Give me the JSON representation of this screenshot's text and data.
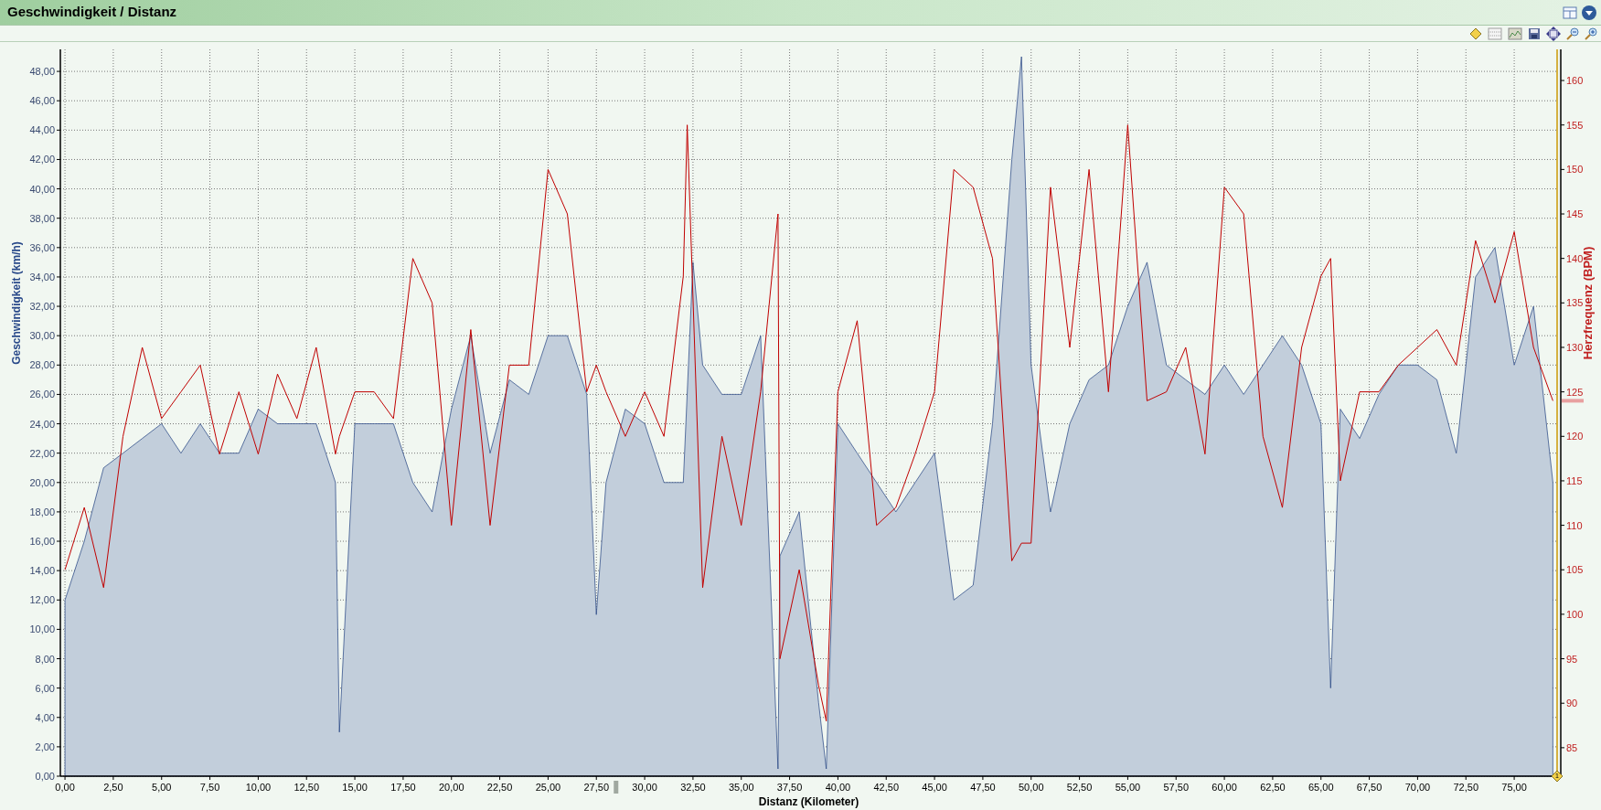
{
  "window": {
    "title": "Geschwindigkeit / Distanz"
  },
  "chart": {
    "marker_label": "1",
    "speed_chart": {
      "chart_data": {
        "type": "area",
        "grid": true,
        "xlabel": "Distanz (Kilometer)",
        "ylabel": "Geschwindigkeit (km/h)",
        "x": [
          0,
          1,
          2,
          3,
          4,
          5,
          6,
          7,
          8,
          9,
          10,
          11,
          12,
          13,
          14,
          14.2,
          15,
          16,
          17,
          18,
          19,
          20,
          21,
          22,
          23,
          24,
          25,
          26,
          27,
          27.5,
          28,
          29,
          30,
          31,
          32,
          32.5,
          33,
          34,
          35,
          36,
          36.9,
          37,
          38,
          39,
          39.4,
          40,
          41,
          42,
          43,
          44,
          45,
          46,
          47,
          48,
          49,
          49.5,
          50,
          51,
          52,
          53,
          54,
          55,
          56,
          57,
          58,
          59,
          60,
          61,
          62,
          63,
          64,
          65,
          65.5,
          66,
          67,
          68,
          69,
          70,
          71,
          72,
          73,
          74,
          75,
          76,
          77
        ],
        "series": [
          {
            "color": "#1f3f80",
            "values": [
              12,
              16,
              21,
              22,
              23,
              24,
              22,
              24,
              22,
              22,
              25,
              24,
              24,
              24,
              20,
              3,
              24,
              24,
              24,
              20,
              18,
              25,
              30,
              22,
              27,
              26,
              30,
              30,
              26,
              11,
              20,
              25,
              24,
              20,
              20,
              35,
              28,
              26,
              26,
              30,
              0.5,
              15,
              18,
              5,
              0.5,
              24,
              22,
              20,
              18,
              20,
              22,
              12,
              13,
              24,
              42,
              49,
              28,
              18,
              24,
              27,
              28,
              32,
              35,
              28,
              27,
              26,
              28,
              26,
              28,
              30,
              28,
              24,
              6,
              25,
              23,
              26,
              28,
              28,
              27,
              22,
              34,
              36,
              28,
              32,
              20
            ]
          }
        ],
        "xlim": [
          -0.24,
          77.22
        ],
        "ylim": [
          0,
          49.5
        ],
        "xticks": [
          {
            "value": 0,
            "label": "0,00"
          },
          {
            "value": 2.5,
            "label": "2,50"
          },
          {
            "value": 5,
            "label": "5,00"
          },
          {
            "value": 7.5,
            "label": "7,50"
          },
          {
            "value": 10,
            "label": "10,00"
          },
          {
            "value": 12.5,
            "label": "12,50"
          },
          {
            "value": 15,
            "label": "15,00"
          },
          {
            "value": 17.5,
            "label": "17,50"
          },
          {
            "value": 20,
            "label": "20,00"
          },
          {
            "value": 22.5,
            "label": "22,50"
          },
          {
            "value": 25,
            "label": "25,00"
          },
          {
            "value": 27.5,
            "label": "27,50"
          },
          {
            "value": 30,
            "label": "30,00"
          },
          {
            "value": 32.5,
            "label": "32,50"
          },
          {
            "value": 35,
            "label": "35,00"
          },
          {
            "value": 37.5,
            "label": "37,50"
          },
          {
            "value": 40,
            "label": "40,00"
          },
          {
            "value": 42.5,
            "label": "42,50"
          },
          {
            "value": 45,
            "label": "45,00"
          },
          {
            "value": 47.5,
            "label": "47,50"
          },
          {
            "value": 50,
            "label": "50,00"
          },
          {
            "value": 52.5,
            "label": "52,50"
          },
          {
            "value": 55,
            "label": "55,00"
          },
          {
            "value": 57.5,
            "label": "57,50"
          },
          {
            "value": 60,
            "label": "60,00"
          },
          {
            "value": 62.5,
            "label": "62,50"
          },
          {
            "value": 65,
            "label": "65,00"
          },
          {
            "value": 67.5,
            "label": "67,50"
          },
          {
            "value": 70,
            "label": "70,00"
          },
          {
            "value": 72.5,
            "label": "72,50"
          },
          {
            "value": 75,
            "label": "75,00"
          }
        ],
        "yticks": [
          {
            "value": 0,
            "label": "0,00"
          },
          {
            "value": 2,
            "label": "2,00"
          },
          {
            "value": 4,
            "label": "4,00"
          },
          {
            "value": 6,
            "label": "6,00"
          },
          {
            "value": 8,
            "label": "8,00"
          },
          {
            "value": 10,
            "label": "10,00"
          },
          {
            "value": 12,
            "label": "12,00"
          },
          {
            "value": 14,
            "label": "14,00"
          },
          {
            "value": 16,
            "label": "16,00"
          },
          {
            "value": 18,
            "label": "18,00"
          },
          {
            "value": 20,
            "label": "20,00"
          },
          {
            "value": 22,
            "label": "22,00"
          },
          {
            "value": 24,
            "label": "24,00"
          },
          {
            "value": 26,
            "label": "26,00"
          },
          {
            "value": 28,
            "label": "28,00"
          },
          {
            "value": 30,
            "label": "30,00"
          },
          {
            "value": 32,
            "label": "32,00"
          },
          {
            "value": 34,
            "label": "34,00"
          },
          {
            "value": 36,
            "label": "36,00"
          },
          {
            "value": 38,
            "label": "38,00"
          },
          {
            "value": 40,
            "label": "40,00"
          },
          {
            "value": 42,
            "label": "42,00"
          },
          {
            "value": 44,
            "label": "44,00"
          },
          {
            "value": 46,
            "label": "46,00"
          },
          {
            "value": 48,
            "label": "48,00"
          }
        ]
      }
    },
    "heart_rate_chart": {
      "chart_data": {
        "type": "line",
        "ylabel": "Herzfrequenz (BPM)",
        "x": [
          0,
          1,
          2,
          3,
          4,
          5,
          6,
          7,
          8,
          9,
          10,
          11,
          12,
          13,
          14,
          14.2,
          15,
          16,
          17,
          18,
          19,
          20,
          21,
          22,
          23,
          24,
          25,
          26,
          27,
          27.5,
          28,
          29,
          30,
          31,
          32,
          32.2,
          33,
          34,
          35,
          36,
          36.9,
          37,
          38,
          39,
          39.4,
          40,
          41,
          42,
          43,
          44,
          45,
          46,
          47,
          48,
          49,
          49.5,
          50,
          51,
          52,
          53,
          54,
          55,
          56,
          57,
          58,
          59,
          60,
          61,
          62,
          63,
          64,
          65,
          65.5,
          66,
          67,
          68,
          69,
          70,
          71,
          72,
          73,
          74,
          75,
          76,
          77
        ],
        "series": [
          {
            "color": "#c00000",
            "values": [
              105,
              112,
              103,
              120,
              130,
              122,
              125,
              128,
              118,
              125,
              118,
              127,
              122,
              130,
              118,
              120,
              125,
              125,
              122,
              140,
              135,
              110,
              132,
              110,
              128,
              128,
              150,
              145,
              125,
              128,
              125,
              120,
              125,
              120,
              138,
              155,
              103,
              120,
              110,
              125,
              145,
              95,
              105,
              92,
              88,
              125,
              133,
              110,
              112,
              118,
              125,
              150,
              148,
              140,
              106,
              108,
              108,
              148,
              130,
              150,
              125,
              155,
              124,
              125,
              130,
              118,
              148,
              145,
              120,
              112,
              130,
              138,
              140,
              115,
              125,
              125,
              128,
              130,
              132,
              128,
              142,
              135,
              143,
              130,
              124
            ]
          }
        ],
        "xlim": [
          -0.24,
          77.22
        ],
        "ylim": [
          81.8,
          163.5
        ],
        "yticks": [
          85,
          90,
          95,
          100,
          105,
          110,
          115,
          120,
          125,
          130,
          135,
          140,
          145,
          150,
          155,
          160
        ]
      }
    }
  }
}
